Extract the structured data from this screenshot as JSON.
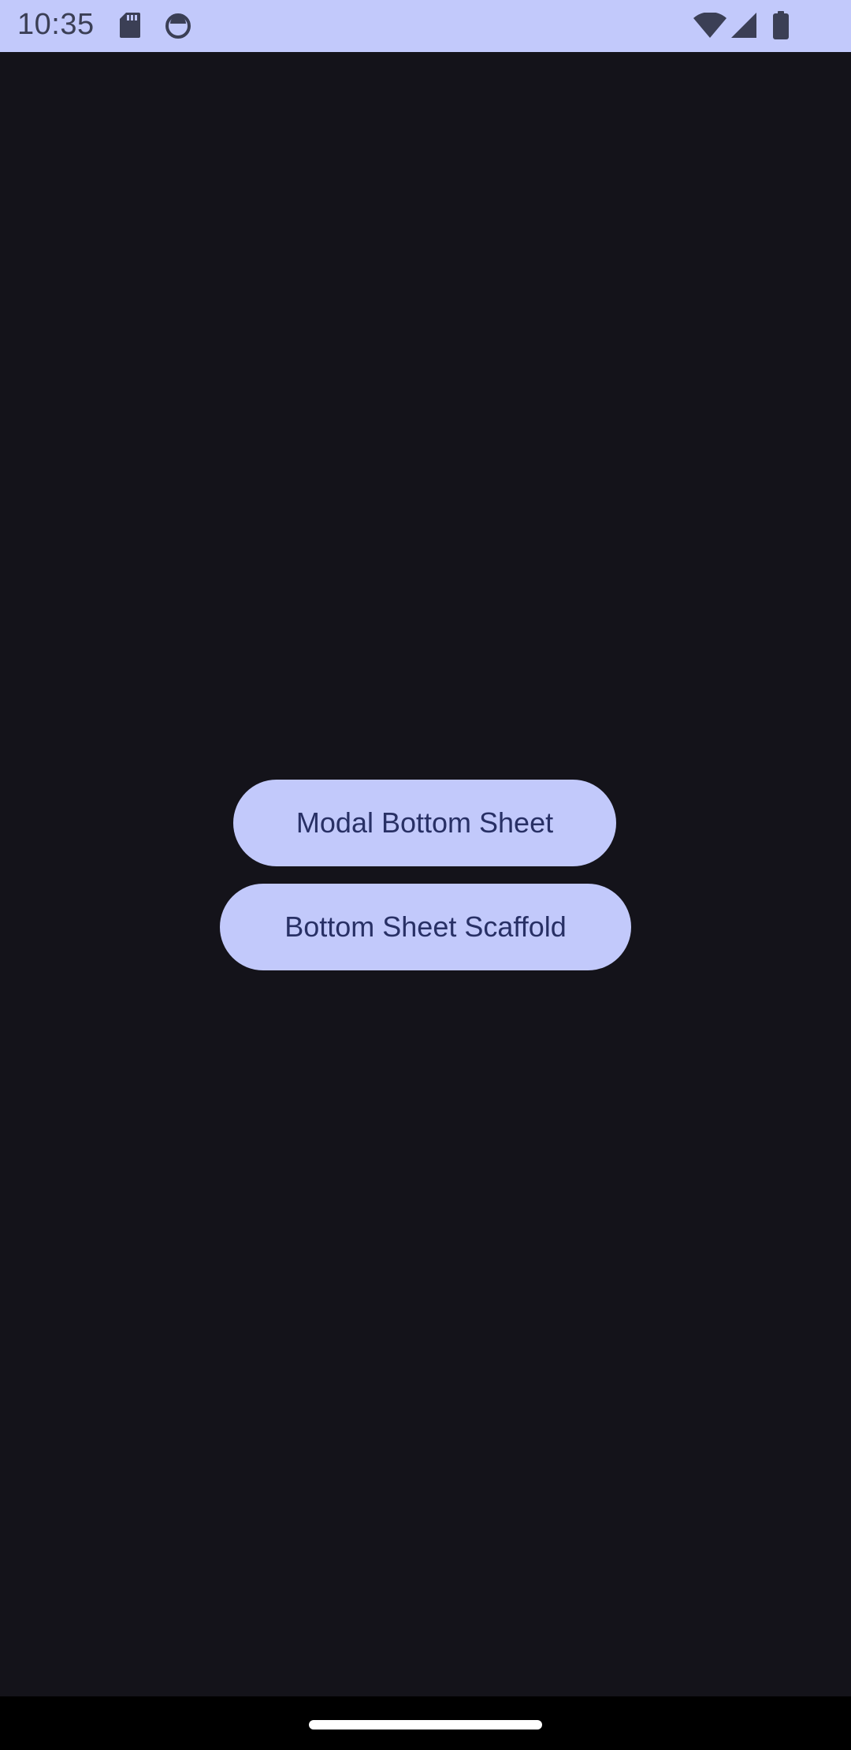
{
  "status_bar": {
    "time": "10:35",
    "left_icons": [
      "sd-card-icon",
      "screen-record-icon"
    ],
    "right_icons": [
      "wifi-icon",
      "cell-signal-icon",
      "battery-icon"
    ],
    "background_color": "#c2c9fb"
  },
  "main": {
    "buttons": [
      {
        "label": "Modal Bottom Sheet"
      },
      {
        "label": "Bottom Sheet Scaffold"
      }
    ],
    "background_color": "#14131a",
    "button_color": "#c2c9fb",
    "button_text_color": "#283065"
  },
  "navigation": {
    "type": "gesture",
    "handle_color": "#ffffff"
  }
}
